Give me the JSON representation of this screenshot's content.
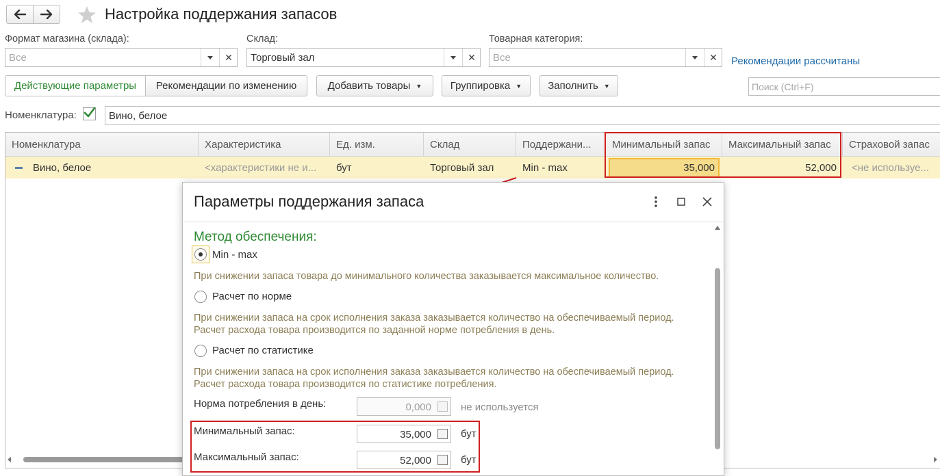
{
  "header": {
    "title": "Настройка поддержания запасов"
  },
  "filters": {
    "store_format": {
      "label": "Формат магазина (склада):",
      "placeholder": "Все",
      "value": ""
    },
    "warehouse": {
      "label": "Склад:",
      "placeholder": "",
      "value": "Торговый зал"
    },
    "category": {
      "label": "Товарная категория:",
      "placeholder": "Все",
      "value": ""
    },
    "recommendations_link": "Рекомендации рассчитаны"
  },
  "toolbar": {
    "tab_active": "Действующие параметры",
    "tab_recommendations": "Рекомендации по изменению",
    "add_goods": "Добавить товары",
    "grouping": "Группировка",
    "fill": "Заполнить",
    "search_placeholder": "Поиск (Ctrl+F)"
  },
  "nomenclature_filter": {
    "label": "Номенклатура:",
    "checked": true,
    "value": "Вино, белое"
  },
  "table": {
    "columns": [
      "Номенклатура",
      "Характеристика",
      "Ед. изм.",
      "Склад",
      "Поддержани...",
      "Минимальный запас",
      "Максимальный запас",
      "Страховой запас"
    ],
    "rows": [
      {
        "nomenclature": "Вино, белое",
        "characteristic": "<характеристики не и...",
        "unit": "бут",
        "warehouse": "Торговый зал",
        "support": "Min - max",
        "min_stock": "35,000",
        "max_stock": "52,000",
        "safety_stock": "<не используе..."
      }
    ]
  },
  "dialog": {
    "title": "Параметры поддержания запаса",
    "section_title": "Метод обеспечения:",
    "options": [
      {
        "label": "Min - max",
        "selected": true,
        "description": [
          "При снижении запаса товара до минимального количества заказывается максимальное количество."
        ]
      },
      {
        "label": "Расчет по норме",
        "selected": false,
        "description": [
          "При снижении запаса на срок исполнения заказа заказывается количество на обеспечиваемый период.",
          "Расчет расхода товара производится по заданной норме потребления в день."
        ]
      },
      {
        "label": "Расчет по статистике",
        "selected": false,
        "description": [
          "При снижении запаса на срок исполнения заказа заказывается количество на обеспечиваемый период.",
          "Расчет расхода товара производится по статистике потребления."
        ]
      }
    ],
    "norm": {
      "label": "Норма потребления в день:",
      "value": "0,000",
      "note": "не используется"
    },
    "min_stock": {
      "label": "Минимальный запас:",
      "value": "35,000",
      "unit": "бут"
    },
    "max_stock": {
      "label": "Максимальный запас:",
      "value": "52,000",
      "unit": "бут"
    }
  },
  "colors": {
    "accent_green": "#2f8a33",
    "link_blue": "#1f6aa8",
    "highlight_red": "#d01f1f",
    "row_highlight": "#fbf2c8"
  }
}
